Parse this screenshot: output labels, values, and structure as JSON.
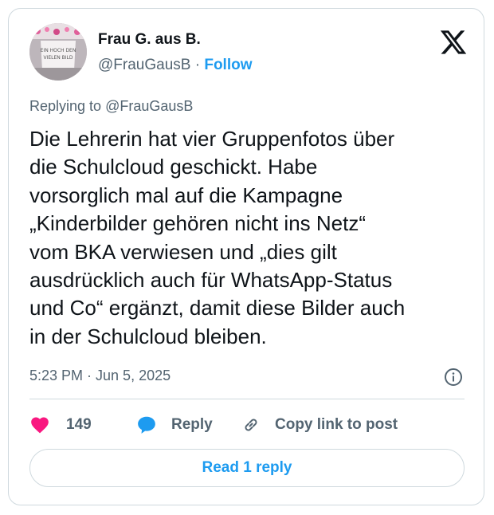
{
  "author": {
    "name": "Frau G. aus B.",
    "handle": "@FrauGausB",
    "separator": "·",
    "follow_label": "Follow",
    "avatar_text": "EIN HOCH DEN VIELEN BILD"
  },
  "platform": {
    "logo_icon": "x-logo-icon"
  },
  "reply_context": {
    "prefix": "Replying to",
    "handle": "@FrauGausB"
  },
  "post": {
    "lines": [
      "Die Lehrerin hat vier Gruppenfotos über",
      "die Schulcloud geschickt. Habe",
      "vorsorglich mal auf die Kampagne",
      "„Kinderbilder gehören nicht ins Netz“",
      "vom BKA verwiesen und „dies gilt",
      "ausdrücklich auch für WhatsApp-Status",
      "und Co“ ergänzt, damit diese Bilder auch",
      "in der Schulcloud bleiben."
    ],
    "timestamp": "5:23 PM · Jun 5, 2025",
    "info_icon": "info-icon"
  },
  "actions": {
    "like_count": "149",
    "like_icon": "heart-icon",
    "like_color": "#f91880",
    "reply_label": "Reply",
    "reply_icon": "speech-bubble-icon",
    "reply_color": "#1d9bf0",
    "copy_label": "Copy link to post",
    "copy_icon": "link-icon"
  },
  "footer": {
    "read_replies_label": "Read 1 reply"
  },
  "colors": {
    "accent": "#1d9bf0",
    "text": "#0f1419",
    "muted": "#536471",
    "border": "#cfd9de"
  }
}
